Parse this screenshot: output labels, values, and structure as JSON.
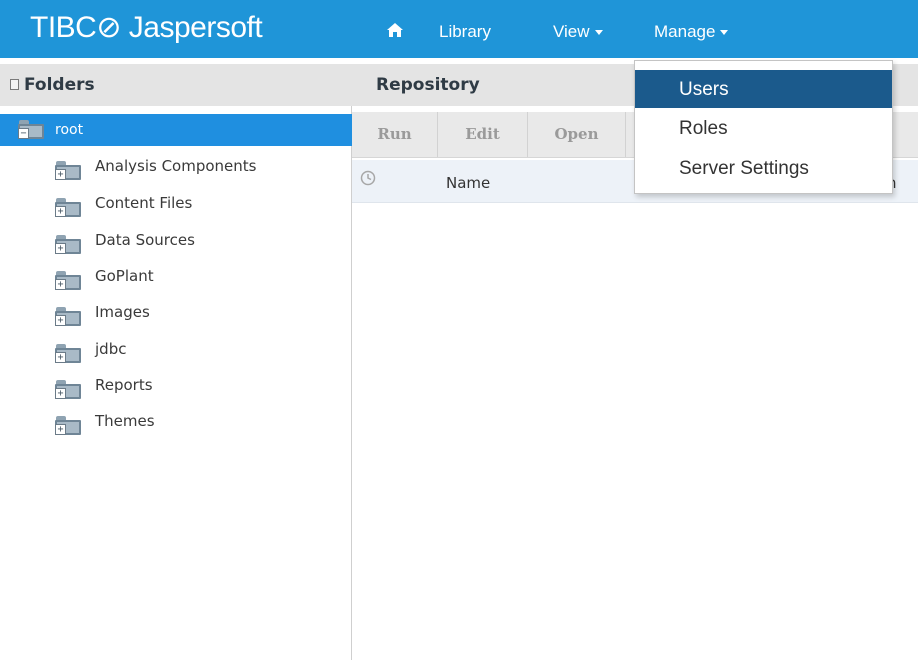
{
  "app": {
    "logo_text": "TIBC⊘ Jaspersoft"
  },
  "nav": {
    "home_icon": "home-icon",
    "items": [
      {
        "label": "Library"
      },
      {
        "label": "View"
      },
      {
        "label": "Manage"
      }
    ]
  },
  "folders_panel": {
    "title": "Folders",
    "root": {
      "label": "root"
    },
    "items": [
      {
        "label": "Analysis Components"
      },
      {
        "label": "Content Files"
      },
      {
        "label": "Data Sources"
      },
      {
        "label": "GoPlant"
      },
      {
        "label": "Images"
      },
      {
        "label": "jdbc"
      },
      {
        "label": "Reports"
      },
      {
        "label": "Themes"
      }
    ]
  },
  "repository": {
    "title": "Repository",
    "toolbar": [
      {
        "label": "Run"
      },
      {
        "label": "Edit"
      },
      {
        "label": "Open"
      }
    ],
    "columns": {
      "name": "Name",
      "truncated": "n"
    }
  },
  "manage_menu": {
    "items": [
      {
        "label": "Users",
        "active": true
      },
      {
        "label": "Roles",
        "active": false
      },
      {
        "label": "Server Settings",
        "active": false
      }
    ]
  },
  "colors": {
    "topbar": "#1f95d8",
    "selection": "#1f8fe0",
    "menu_active": "#1b5a8c"
  }
}
